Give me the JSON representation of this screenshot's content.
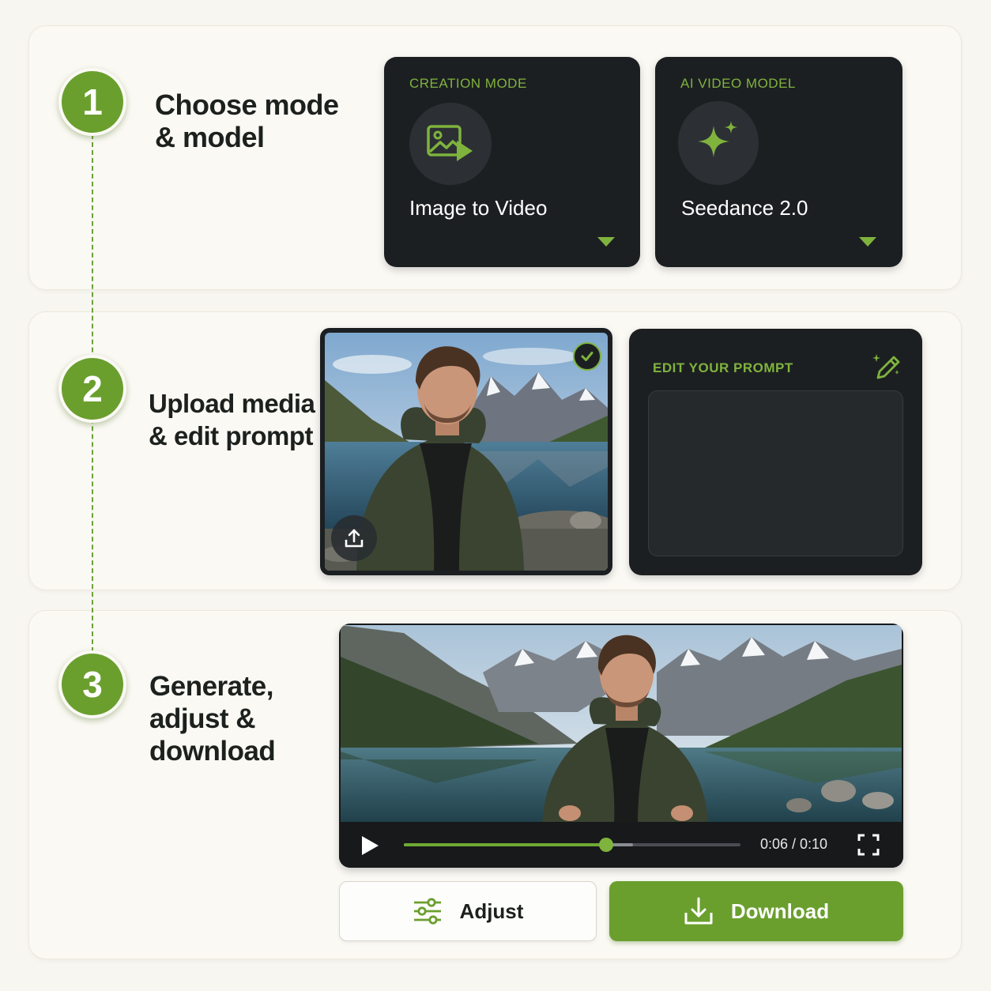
{
  "colors": {
    "accent": "#6a9f2e",
    "accent_light": "#7fb33d",
    "panel_dark": "#1c1f22",
    "card_background": "#fbf9f4"
  },
  "steps": [
    {
      "number": "1",
      "title_lines": [
        "Choose mode",
        "& model"
      ]
    },
    {
      "number": "2",
      "title_lines": [
        "Upload media",
        "& edit prompt"
      ]
    },
    {
      "number": "3",
      "title_lines": [
        "Generate,",
        "adjust &",
        "download"
      ]
    }
  ],
  "creation_mode": {
    "label": "CREATION MODE",
    "value": "Image to Video",
    "icon": "image-play-icon"
  },
  "ai_model": {
    "label": "AI VIDEO MODEL",
    "value": "Seedance 2.0",
    "icon": "sparkle-icon"
  },
  "upload": {
    "image_description_icon": "uploaded-photo",
    "selected": true,
    "upload_icon": "upload-icon",
    "check_icon": "check-icon"
  },
  "prompt": {
    "label": "EDIT YOUR PROMPT",
    "value": "",
    "icon": "pencil-sparkle-icon"
  },
  "player": {
    "current_time": "0:06",
    "duration": "0:10",
    "time_display": "0:06 / 0:10",
    "progress_fraction": 0.6,
    "buffered_fraction": 0.68,
    "play_icon": "play-icon",
    "fullscreen_icon": "fullscreen-icon"
  },
  "actions": {
    "adjust_label": "Adjust",
    "adjust_icon": "sliders-icon",
    "download_label": "Download",
    "download_icon": "download-icon"
  }
}
